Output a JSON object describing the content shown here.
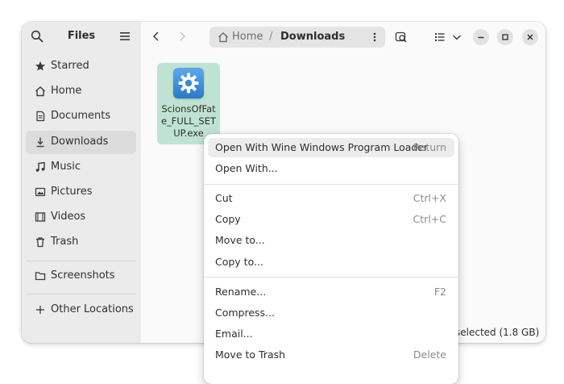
{
  "sidebar": {
    "title": "Files",
    "items": [
      {
        "label": "Starred",
        "icon": "star-icon"
      },
      {
        "label": "Home",
        "icon": "home-icon"
      },
      {
        "label": "Documents",
        "icon": "document-icon"
      },
      {
        "label": "Downloads",
        "icon": "download-icon",
        "active": true
      },
      {
        "label": "Music",
        "icon": "music-icon"
      },
      {
        "label": "Pictures",
        "icon": "picture-icon"
      },
      {
        "label": "Videos",
        "icon": "video-icon"
      },
      {
        "label": "Trash",
        "icon": "trash-icon"
      },
      {
        "label": "Screenshots",
        "icon": "folder-icon"
      },
      {
        "label": "Other Locations",
        "icon": "plus-icon"
      }
    ]
  },
  "pathbar": {
    "home": "Home",
    "separator": "/",
    "current": "Downloads"
  },
  "file": {
    "name": "ScionsOfFate_FULL_SETUP.exe",
    "icon": "wine-gear-icon"
  },
  "status": {
    "text": "selected (1.8 GB)"
  },
  "context_menu": {
    "groups": [
      [
        {
          "label": "Open With Wine Windows Program Loader",
          "shortcut": "Return",
          "highlighted": true
        },
        {
          "label": "Open With...",
          "shortcut": ""
        }
      ],
      [
        {
          "label": "Cut",
          "shortcut": "Ctrl+X"
        },
        {
          "label": "Copy",
          "shortcut": "Ctrl+C"
        },
        {
          "label": "Move to...",
          "shortcut": ""
        },
        {
          "label": "Copy to...",
          "shortcut": ""
        }
      ],
      [
        {
          "label": "Rename...",
          "shortcut": "F2"
        },
        {
          "label": "Compress...",
          "shortcut": ""
        },
        {
          "label": "Email...",
          "shortcut": ""
        },
        {
          "label": "Move to Trash",
          "shortcut": "Delete"
        }
      ]
    ]
  },
  "colors": {
    "selection": "#bfe3d3",
    "sidebar_bg": "#ebebeb",
    "accent": "#2b78c9"
  }
}
